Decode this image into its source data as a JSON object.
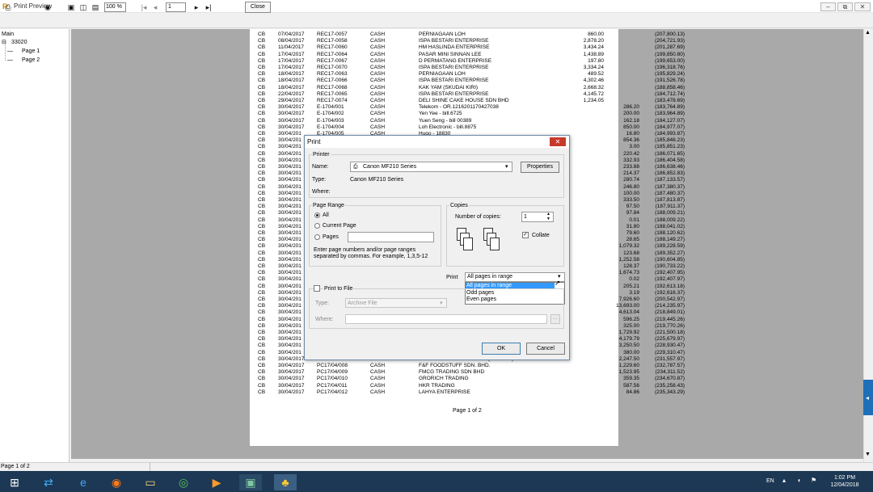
{
  "window": {
    "title": "Print Preview",
    "min": "–",
    "max": "⧉",
    "close": "✕"
  },
  "toolbar": {
    "zoom": "100 %",
    "page": "1",
    "close_label": "Close"
  },
  "tree": {
    "root": "Main",
    "node": "33020",
    "pages": [
      "Page 1",
      "Page 2"
    ]
  },
  "report": {
    "rows": [
      [
        "CB",
        "07/04/2017",
        "REC17-0057",
        "CASH",
        "PERNIAGAAN LOH",
        "860.00",
        "",
        "(207,800.13)"
      ],
      [
        "CB",
        "08/04/2017",
        "REC17-0058",
        "CASH",
        "ISPA BESTARI ENTERPRISE",
        "2,878.20",
        "",
        "(204,721.93)"
      ],
      [
        "CB",
        "11/04/2017",
        "REC17-0060",
        "CASH",
        "HM HASLINDA ENTERPRISE",
        "3,434.24",
        "",
        "(201,287.69)"
      ],
      [
        "CB",
        "17/04/2017",
        "REC17-0064",
        "CASH",
        "PASAR MINI SINNAN LEE",
        "1,438.89",
        "",
        "(199,850.80)"
      ],
      [
        "CB",
        "17/04/2017",
        "REC17-0067",
        "CASH",
        "D PERMATANG ENTERPRISE",
        "197.80",
        "",
        "(199,653.00)"
      ],
      [
        "CB",
        "17/04/2017",
        "REC17-0070",
        "CASH",
        "ISPA BESTARI ENTERPRISE",
        "3,334.24",
        "",
        "(196,318.76)"
      ],
      [
        "CB",
        "18/04/2017",
        "REC17-0063",
        "CASH",
        "PERNIAGAAN LOH",
        "489.52",
        "",
        "(195,829.24)"
      ],
      [
        "CB",
        "18/04/2017",
        "REC17-0066",
        "CASH",
        "ISPA BESTARI ENTERPRISE",
        "4,302.46",
        "",
        "(191,526.78)"
      ],
      [
        "CB",
        "18/04/2017",
        "REC17-0068",
        "CASH",
        "KAK YAM (SKUDAI KIRI)",
        "2,668.32",
        "",
        "(188,858.46)"
      ],
      [
        "CB",
        "22/04/2017",
        "REC17-0065",
        "CASH",
        "ISPA BESTARI ENTERPRISE",
        "4,145.72",
        "",
        "(184,712.74)"
      ],
      [
        "CB",
        "29/04/2017",
        "REC17-0074",
        "CASH",
        "DELI SHINE CAKE HOUSE SDN BHD",
        "1,234.05",
        "",
        "(183,478.69)"
      ],
      [
        "CB",
        "30/04/2017",
        "E-1704/001",
        "CASH",
        "Telekom - OR.1216201170427038",
        "",
        "286.20",
        "(183,764.89)"
      ],
      [
        "CB",
        "30/04/2017",
        "E-1704/002",
        "CASH",
        "Yen Yee - bill.6725",
        "",
        "200.00",
        "(183,964.89)"
      ],
      [
        "CB",
        "30/04/2017",
        "E-1704/003",
        "CASH",
        "Yuen Seng - bill 00389",
        "",
        "162.18",
        "(184,127.07)"
      ],
      [
        "CB",
        "30/04/2017",
        "E-1704/004",
        "CASH",
        "Loh Electronic - bill.8875",
        "",
        "850.00",
        "(184,977.07)"
      ],
      [
        "CB",
        "30/04/201",
        "E-1704/005",
        "CASH",
        "Hugo - 18830",
        "",
        "16.80",
        "(184,993.87)"
      ],
      [
        "CB",
        "30/04/201",
        "",
        "",
        "",
        "",
        "854.36",
        "(185,848.23)"
      ],
      [
        "CB",
        "30/04/201",
        "",
        "",
        "",
        "",
        "3.00",
        "(185,851.23)"
      ],
      [
        "CB",
        "30/04/201",
        "",
        "",
        "",
        "",
        "220.42",
        "(186,071.65)"
      ],
      [
        "CB",
        "30/04/201",
        "",
        "",
        "",
        "",
        "332.93",
        "(186,404.58)"
      ],
      [
        "CB",
        "30/04/201",
        "",
        "",
        "",
        "",
        "233.88",
        "(186,638.46)"
      ],
      [
        "CB",
        "30/04/201",
        "",
        "",
        "",
        "",
        "214.37",
        "(186,852.83)"
      ],
      [
        "CB",
        "30/04/201",
        "",
        "",
        "",
        "",
        "280.74",
        "(187,133.57)"
      ],
      [
        "CB",
        "30/04/201",
        "",
        "",
        "",
        "",
        "246.80",
        "(187,380.37)"
      ],
      [
        "CB",
        "30/04/201",
        "",
        "",
        "",
        "",
        "100.00",
        "(187,480.37)"
      ],
      [
        "CB",
        "30/04/201",
        "",
        "",
        "",
        "",
        "333.50",
        "(187,813.87)"
      ],
      [
        "CB",
        "30/04/201",
        "",
        "",
        "",
        "",
        "97.50",
        "(187,911.37)"
      ],
      [
        "CB",
        "30/04/201",
        "",
        "",
        "",
        "",
        "97.84",
        "(188,009.21)"
      ],
      [
        "CB",
        "30/04/201",
        "",
        "",
        "",
        "",
        "0.01",
        "(188,009.22)"
      ],
      [
        "CB",
        "30/04/201",
        "",
        "",
        "",
        "",
        "31.80",
        "(188,041.02)"
      ],
      [
        "CB",
        "30/04/201",
        "",
        "",
        "",
        "",
        "79.60",
        "(188,120.62)"
      ],
      [
        "CB",
        "30/04/201",
        "",
        "",
        "",
        "",
        "28.65",
        "(188,149.27)"
      ],
      [
        "CB",
        "30/04/201",
        "",
        "",
        "",
        "",
        "1,079.32",
        "(189,228.59)"
      ],
      [
        "CB",
        "30/04/201",
        "",
        "",
        "",
        "",
        "123.68",
        "(189,352.27)"
      ],
      [
        "CB",
        "30/04/201",
        "",
        "",
        "",
        "",
        "1,252.58",
        "(190,604.85)"
      ],
      [
        "CB",
        "30/04/201",
        "",
        "",
        "",
        "",
        "128.37",
        "(190,733.22)"
      ],
      [
        "CB",
        "30/04/201",
        "",
        "",
        "",
        "",
        "1,674.73",
        "(192,407.95)"
      ],
      [
        "CB",
        "30/04/201",
        "",
        "",
        "",
        "",
        "0.02",
        "(192,407.97)"
      ],
      [
        "CB",
        "30/04/201",
        "",
        "",
        "",
        "",
        "205.21",
        "(192,613.18)"
      ],
      [
        "CB",
        "30/04/201",
        "",
        "",
        "",
        "",
        "3.19",
        "(192,616.37)"
      ],
      [
        "CB",
        "30/04/201",
        "",
        "",
        "",
        "",
        "7,926.60",
        "(200,542.97)"
      ],
      [
        "CB",
        "30/04/201",
        "",
        "",
        "",
        "",
        "13,693.00",
        "(214,235.97)"
      ],
      [
        "CB",
        "30/04/201",
        "",
        "",
        "",
        "",
        "4,613.04",
        "(218,849.01)"
      ],
      [
        "CB",
        "30/04/201",
        "",
        "",
        "",
        "",
        "596.25",
        "(219,445.26)"
      ],
      [
        "CB",
        "30/04/201",
        "",
        "",
        "",
        "",
        "325.00",
        "(219,770.26)"
      ],
      [
        "CB",
        "30/04/201",
        "",
        "",
        "",
        "",
        "1,729.92",
        "(221,500.18)"
      ],
      [
        "CB",
        "30/04/201",
        "",
        "",
        "",
        "",
        "4,179.79",
        "(225,679.97)"
      ],
      [
        "CB",
        "30/04/201",
        "",
        "",
        "",
        "",
        "3,250.50",
        "(228,930.47)"
      ],
      [
        "CB",
        "30/04/201",
        "",
        "",
        "",
        "",
        "380.00",
        "(229,310.47)"
      ],
      [
        "CB",
        "30/04/2017",
        "PC17/04/007",
        "CASH",
        "FEDERATION OIL FACTORY(JOHORE)SDN. BHD.",
        "",
        "2,247.50",
        "(231,557.97)"
      ],
      [
        "CB",
        "30/04/2017",
        "PC17/04/008",
        "CASH",
        "F&F FOODSTUFF SDN. BHD.",
        "",
        "1,229.60",
        "(232,787.57)"
      ],
      [
        "CB",
        "30/04/2017",
        "PC17/04/009",
        "CASH",
        "FMCG TRADING SDN BHD",
        "",
        "1,523.95",
        "(234,311.52)"
      ],
      [
        "CB",
        "30/04/2017",
        "PC17/04/010",
        "CASH",
        "GRORICH TRADING",
        "",
        "359.35",
        "(234,670.87)"
      ],
      [
        "CB",
        "30/04/2017",
        "PC17/04/011",
        "CASH",
        "HKR TRADING",
        "",
        "587.56",
        "(235,258.43)"
      ],
      [
        "CB",
        "30/04/2017",
        "PC17/04/012",
        "CASH",
        "LAHYA ENTERPRISE",
        "",
        "84.86",
        "(235,343.29)"
      ]
    ],
    "footer": "Page 1 of 2"
  },
  "status": "Page 1 of 2",
  "taskbar": {
    "lang": "EN",
    "time": "1:02 PM",
    "date": "12/04/2018"
  },
  "dialog": {
    "title": "Print",
    "printer_group": "Printer",
    "name_label": "Name:",
    "printer_name": "Canon MF210 Series",
    "properties": "Properties",
    "type_label": "Type:",
    "type_value": "Canon MF210 Series",
    "where_label": "Where:",
    "range_group": "Page Range",
    "all": "All",
    "current_page": "Current Page",
    "pages": "Pages",
    "hint": "Enter page numbers and/or page ranges separated by commas. For example, 1,3,5-12",
    "copies_group": "Copies",
    "copies_label": "Number of copies:",
    "copies_value": "1",
    "collate": "Collate",
    "print_label": "Print",
    "print_selected": "All pages in range",
    "print_options": [
      "All pages in range",
      "Odd pages",
      "Even pages"
    ],
    "print_to_file": "Print to File",
    "file_type_label": "Type:",
    "file_type_value": "Archive File",
    "file_where_label": "Where:",
    "ok": "OK",
    "cancel": "Cancel"
  }
}
